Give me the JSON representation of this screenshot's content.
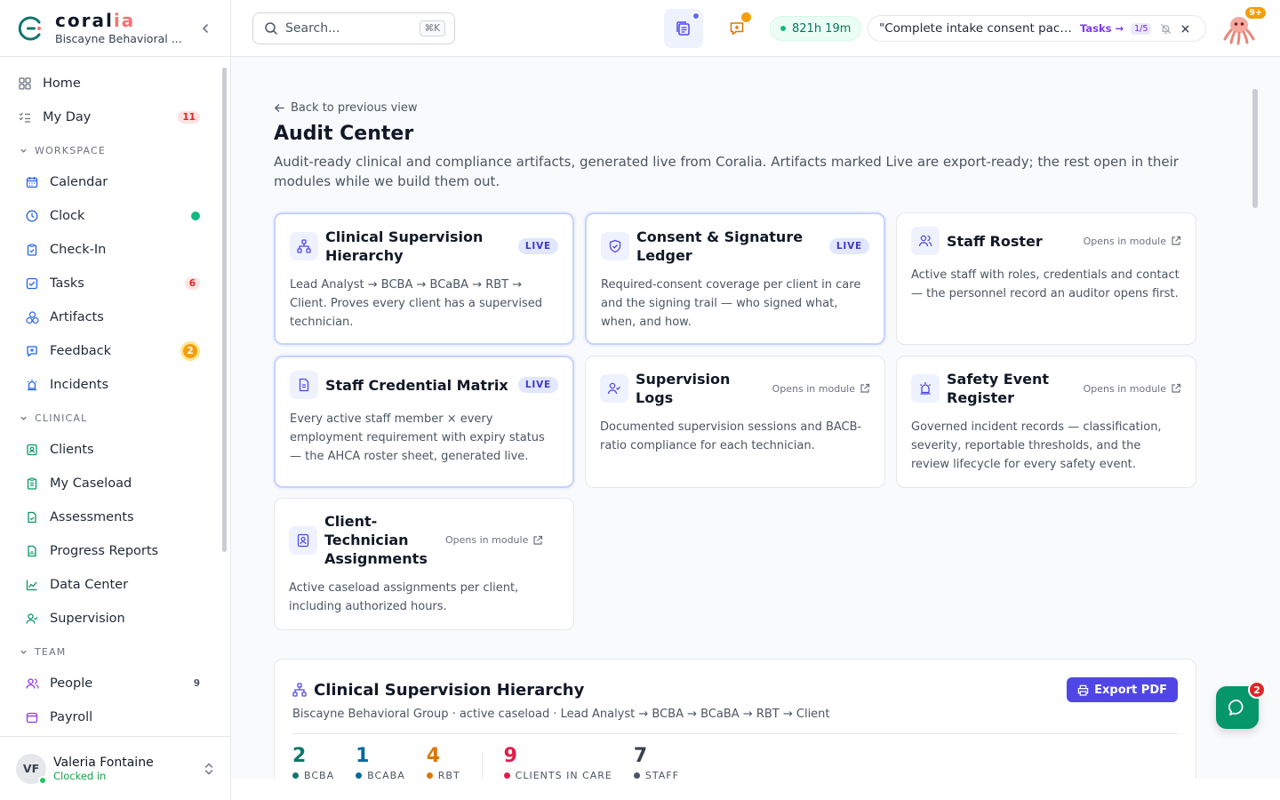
{
  "brand": {
    "name_main": "coral",
    "name_accent": "ia",
    "org": "Biscayne Behavioral ..."
  },
  "nav": {
    "top": [
      {
        "label": "Home",
        "icon": "home-grid-icon"
      },
      {
        "label": "My Day",
        "icon": "checklist-icon",
        "badge": "11"
      }
    ],
    "sections": [
      {
        "title": "WORKSPACE",
        "items": [
          {
            "label": "Calendar",
            "icon": "calendar-icon",
            "color": "#2563eb"
          },
          {
            "label": "Clock",
            "icon": "clock-icon",
            "color": "#2563eb",
            "dot": "#10b981"
          },
          {
            "label": "Check-In",
            "icon": "clipboard-icon",
            "color": "#2563eb"
          },
          {
            "label": "Tasks",
            "icon": "checkbox-icon",
            "color": "#2563eb",
            "badge": "6"
          },
          {
            "label": "Artifacts",
            "icon": "hexagons-icon",
            "color": "#2563eb"
          },
          {
            "label": "Feedback",
            "icon": "feedback-icon",
            "color": "#2563eb",
            "badge_amber": "2"
          },
          {
            "label": "Incidents",
            "icon": "alarm-icon",
            "color": "#2563eb"
          }
        ]
      },
      {
        "title": "CLINICAL",
        "items": [
          {
            "label": "Clients",
            "icon": "id-badge-icon",
            "color": "#059669"
          },
          {
            "label": "My Caseload",
            "icon": "clipboard-list-icon",
            "color": "#059669"
          },
          {
            "label": "Assessments",
            "icon": "file-check-icon",
            "color": "#059669"
          },
          {
            "label": "Progress Reports",
            "icon": "file-chart-icon",
            "color": "#059669"
          },
          {
            "label": "Data Center",
            "icon": "line-chart-icon",
            "color": "#059669"
          },
          {
            "label": "Supervision",
            "icon": "user-check-icon",
            "color": "#059669"
          }
        ]
      },
      {
        "title": "TEAM",
        "items": [
          {
            "label": "People",
            "icon": "users-icon",
            "color": "#9333ea",
            "count": "9"
          },
          {
            "label": "Payroll",
            "icon": "wallet-icon",
            "color": "#9333ea"
          }
        ]
      }
    ]
  },
  "user": {
    "initials": "VF",
    "name": "Valeria Fontaine",
    "status": "Clocked in"
  },
  "topbar": {
    "search_placeholder": "Search...",
    "search_shortcut": "⌘K",
    "timer": "821h 19m",
    "task_text": "\"Complete intake consent pack...",
    "task_link": "Tasks →",
    "task_count": "1/5",
    "avatar_badge": "9+"
  },
  "page": {
    "back": "Back to previous view",
    "title": "Audit Center",
    "description": "Audit-ready clinical and compliance artifacts, generated live from Coralia. Artifacts marked Live are export-ready; the rest open in their modules while we build them out."
  },
  "cards": [
    {
      "title": "Clinical Supervision Hierarchy",
      "icon": "hierarchy-icon",
      "status": "LIVE",
      "desc": "Lead Analyst → BCBA → BCaBA → RBT → Client. Proves every client has a supervised technician."
    },
    {
      "title": "Consent & Signature Ledger",
      "icon": "shield-check-icon",
      "status": "LIVE",
      "desc": "Required-consent coverage per client in care and the signing trail — who signed what, when, and how."
    },
    {
      "title": "Staff Roster",
      "icon": "users-icon",
      "status": "Opens in module",
      "desc": "Active staff with roles, credentials and contact — the personnel record an auditor opens first."
    },
    {
      "title": "Staff Credential Matrix",
      "icon": "document-icon",
      "status": "LIVE",
      "desc": "Every active staff member × every employment requirement with expiry status — the AHCA roster sheet, generated live."
    },
    {
      "title": "Supervision Logs",
      "icon": "user-check-icon",
      "status": "Opens in module",
      "desc": "Documented supervision sessions and BACB-ratio compliance for each technician."
    },
    {
      "title": "Safety Event Register",
      "icon": "alarm-icon",
      "status": "Opens in module",
      "desc": "Governed incident records — classification, severity, reportable thresholds, and the review lifecycle for every safety event."
    },
    {
      "title": "Client-Technician Assignments",
      "icon": "id-badge-icon",
      "status": "Opens in module",
      "desc": "Active caseload assignments per client, including authorized hours."
    }
  ],
  "panel": {
    "title": "Clinical Supervision Hierarchy",
    "export": "Export PDF",
    "subtitle": "Biscayne Behavioral Group · active caseload · Lead Analyst → BCBA → BCaBA → RBT → Client",
    "stats": [
      {
        "value": "2",
        "label": "BCBA",
        "color": "#0f766e"
      },
      {
        "value": "1",
        "label": "BCABA",
        "color": "#0369a1"
      },
      {
        "value": "4",
        "label": "RBT",
        "color": "#d97706"
      },
      {
        "value": "9",
        "label": "CLIENTS IN CARE",
        "color": "#e11d48"
      },
      {
        "value": "7",
        "label": "STAFF",
        "color": "#374151"
      }
    ]
  },
  "chat": {
    "badge": "2"
  }
}
